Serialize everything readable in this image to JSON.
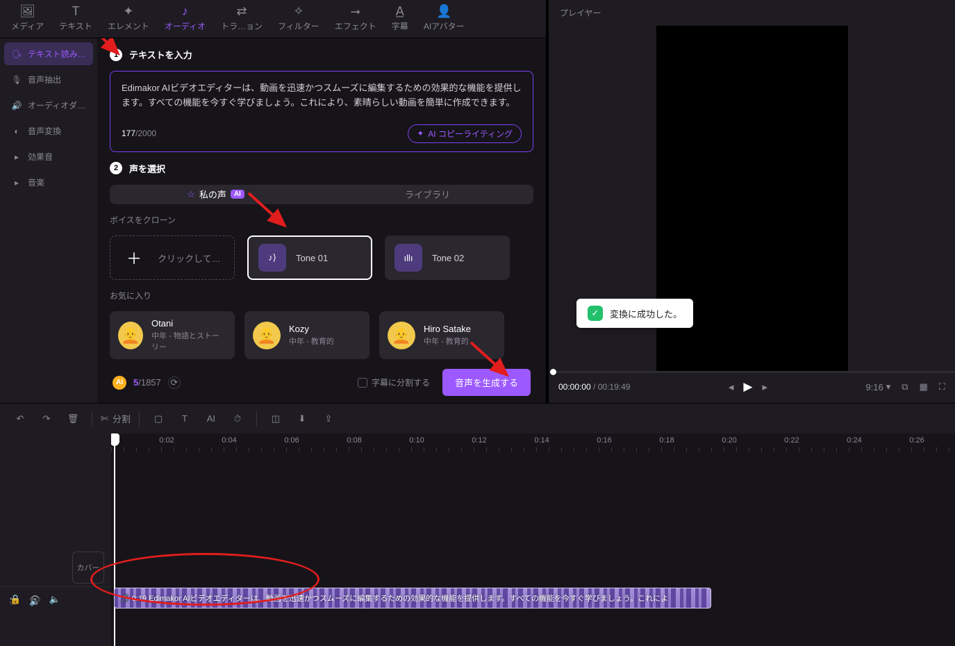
{
  "tabs": {
    "media": "メディア",
    "text": "テキスト",
    "elements": "エレメント",
    "audio": "オーディオ",
    "trans": "トラ…ョン",
    "filter": "フィルター",
    "effect": "エフェクト",
    "subtitle": "字幕",
    "avatar": "AIアバター"
  },
  "sidebar": {
    "tts": "テキスト読み…",
    "extract": "音声抽出",
    "dub": "オーディオダ…",
    "vc": "音声変換",
    "sfx": "効果音",
    "music": "音楽"
  },
  "step1": {
    "title": "テキストを入力",
    "text": "Edimakor AIビデオエディターは、動画を迅速かつスムーズに編集するための効果的な機能を提供します。すべての機能を今すぐ学びましょう。これにより、素晴らしい動画を簡単に作成できます。",
    "count_cur": "177",
    "count_max": "/2000",
    "ai_btn": "AI コピーライティング"
  },
  "step2": {
    "title": "声を選択",
    "tab_my": "私の声",
    "tab_lib": "ライブラリ",
    "ai_badge": "AI",
    "clone_label": "ボイスをクローン",
    "click_label": "クリックして…",
    "tone1": "Tone 01",
    "tone2": "Tone 02",
    "fav_label": "お気に入り",
    "fav": [
      {
        "name": "Otani",
        "desc": "中年 - 物語とストーリー"
      },
      {
        "name": "Kozy",
        "desc": "中年 - 教育的"
      },
      {
        "name": "Hiro Satake",
        "desc": "中年 - 教育的"
      }
    ]
  },
  "footer": {
    "cred_cur": "5",
    "cred_max": "/1857",
    "split_check": "字幕に分割する",
    "generate": "音声を生成する"
  },
  "player": {
    "title": "プレイヤー",
    "toast": "変換に成功した。",
    "time_cur": "00:00:00",
    "time_max": " / 00:19:49",
    "ratio": "9:16"
  },
  "toolbar": {
    "split": "分割"
  },
  "ruler": [
    "0:02",
    "0:04",
    "0:06",
    "0:08",
    "0:10",
    "0:12",
    "0:14",
    "0:16",
    "0:18",
    "0:20",
    "0:22",
    "0:24",
    "0:26"
  ],
  "clip": {
    "label": "🎵 0:19 Edimakor AIビデオエディターは、動画を迅速かつスムーズに編集するための効果的な機能を提供します。すべての機能を今すぐ学びましょう。これによ"
  },
  "cover": "カバー"
}
